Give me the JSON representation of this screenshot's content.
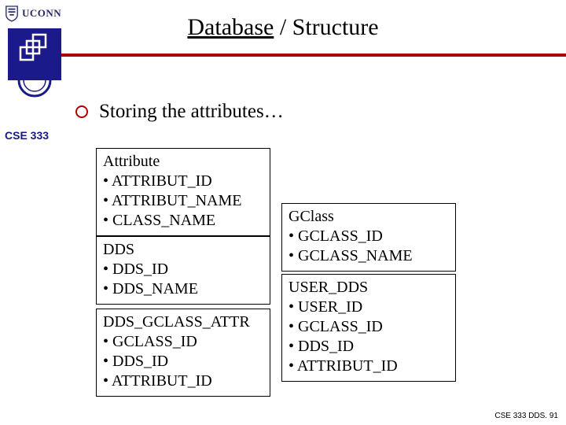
{
  "header": {
    "org": "UCONN",
    "title_underlined": "Database",
    "title_rest": " / Structure"
  },
  "course": "CSE 333",
  "bullet": "Storing the attributes…",
  "tables": {
    "attribute": {
      "name": "Attribute",
      "fields": [
        "ATTRIBUT_ID",
        "ATTRIBUT_NAME",
        "CLASS_NAME"
      ]
    },
    "dds": {
      "name": "DDS",
      "fields": [
        "DDS_ID",
        "DDS_NAME"
      ]
    },
    "dga": {
      "name": "DDS_GCLASS_ATTR",
      "fields": [
        "GCLASS_ID",
        "DDS_ID",
        "ATTRIBUT_ID"
      ]
    },
    "gclass": {
      "name": "GClass",
      "fields": [
        "GCLASS_ID",
        "GCLASS_NAME"
      ]
    },
    "userdds": {
      "name": "USER_DDS",
      "fields": [
        "USER_ID",
        "GCLASS_ID",
        "DDS_ID",
        "ATTRIBUT_ID"
      ]
    }
  },
  "footer": "CSE 333 DDS. 91"
}
